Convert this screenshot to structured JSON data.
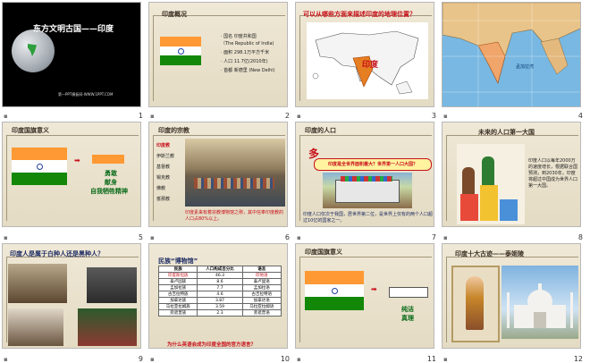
{
  "slides": [
    {
      "number": "1",
      "title": "东方文明古国——印度",
      "footer": "第一PPT模板网-WWW.1PPT.COM"
    },
    {
      "number": "2",
      "title": "印度概况",
      "facts": [
        "· 国名 印度共和国",
        "（The Republic of India)",
        "· 面积 298.1万平方千米",
        "· 人口 11.7亿(2010年)",
        "· 首都 新德里 (New Delhi)"
      ]
    },
    {
      "number": "3",
      "question": "可以从哪些方面来描述印度的地理位置？",
      "map_label": "印度"
    },
    {
      "number": "4",
      "labels": [
        "孟加拉湾"
      ]
    },
    {
      "number": "5",
      "title": "印度国旗意义",
      "meaning": [
        "勇敢",
        "献身",
        "自我牺牲精神"
      ]
    },
    {
      "number": "6",
      "title": "印度的宗教",
      "religions": [
        "印度教",
        "伊斯兰教",
        "基督教",
        "锡克教",
        "佛教",
        "耆那教"
      ],
      "note": "印度素来有着宗教博物馆之称，其中信奉印度教的人口占80%以上。"
    },
    {
      "number": "7",
      "title": "印度的人口",
      "banner": "印度是全世界面积最大？世界第一人口大国？",
      "caption": "印度人口仅次于我国，居世界第二位，是世界上仅有的两个人口超过10亿的国家之一。"
    },
    {
      "number": "8",
      "title": "未来的人口第一大国",
      "body": "印度人口以每年2000万的速度增长，根据联合国预测，到2030年，印度将超过中国成为世界人口第一大国。"
    },
    {
      "number": "9",
      "question": "印度人是属于白种人还是黑种人？"
    },
    {
      "number": "10",
      "title": "民族“博物馆”",
      "table": {
        "headers": [
          "民族",
          "人口构成百分比",
          "语言"
        ],
        "rows": [
          [
            "印度斯坦族",
            "46.3",
            "印地语"
          ],
          [
            "泰卢固族",
            "8.6",
            "泰卢固语"
          ],
          [
            "孟加拉族",
            "7.7",
            "孟加拉语"
          ],
          [
            "古吉拉特族",
            "4.6",
            "古吉拉特语"
          ],
          [
            "加拿达族",
            "3.87",
            "加拿达语"
          ],
          [
            "马拉亚拉姆族",
            "3.59",
            "马拉亚拉姆语"
          ],
          [
            "旁遮普族",
            "2.3",
            "旁遮普语"
          ]
        ]
      },
      "question": "为什么英语会成为印度全国的官方语言？"
    },
    {
      "number": "11",
      "title": "印度国旗意义",
      "meaning": [
        "纯洁",
        "真理"
      ]
    },
    {
      "number": "12",
      "title": "印度十大古迹——泰姬陵"
    }
  ],
  "colors": {
    "accent_red": "#d4141a",
    "saffron": "#ff9933",
    "green": "#138808",
    "navy": "#1f3f9f"
  }
}
